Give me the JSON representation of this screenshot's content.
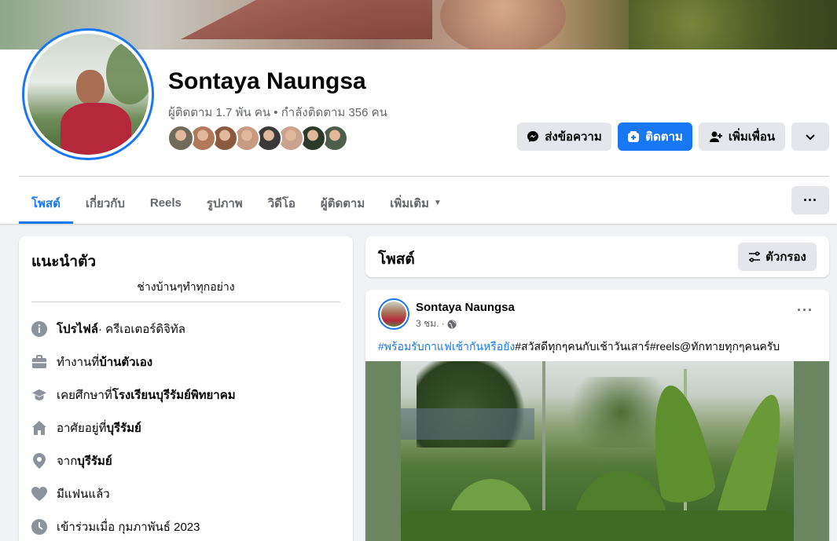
{
  "profile": {
    "name": "Sontaya Naungsa",
    "stats": "ผู้ติดตาม 1.7 พัน คน • กำลังติดตาม 356 คน",
    "friend_avatar_colors": [
      "#6f6a5a",
      "#b07a5a",
      "#8a5a3e",
      "#c89a82",
      "#3a3a3a",
      "#c9a38d",
      "#2d3a2a",
      "#4e5e4a"
    ]
  },
  "actions": {
    "message": "ส่งข้อความ",
    "follow": "ติดตาม",
    "add_friend": "เพิ่มเพื่อน"
  },
  "tabs": [
    "โพสต์",
    "เกี่ยวกับ",
    "Reels",
    "รูปภาพ",
    "วิดีโอ",
    "ผู้ติดตาม",
    "เพิ่มเติม"
  ],
  "intro": {
    "title": "แนะนำตัว",
    "bio": "ช่างบ้านๆทำทุกอย่าง",
    "items": [
      {
        "icon": "info-icon",
        "bold": "โปรไฟล์",
        "text": " · ครีเอเตอร์ดิจิทัล"
      },
      {
        "icon": "briefcase-icon",
        "text": "ทำงานที่ ",
        "bold": "บ้านตัวเอง"
      },
      {
        "icon": "graduation-cap-icon",
        "text": "เคยศึกษาที่ ",
        "bold": "โรงเรียนบุรีรัมย์พิทยาคม"
      },
      {
        "icon": "home-icon",
        "text": "อาศัยอยู่ที่ ",
        "bold": "บุรีรัมย์"
      },
      {
        "icon": "location-pin-icon",
        "text": "จาก ",
        "bold": "บุรีรัมย์"
      },
      {
        "icon": "heart-icon",
        "text": "มีแฟนแล้ว"
      },
      {
        "icon": "clock-icon",
        "text": "เข้าร่วมเมื่อ กุมภาพันธ์ 2023"
      }
    ]
  },
  "posts": {
    "title": "โพสต์",
    "filter_label": "ตัวกรอง",
    "post": {
      "author": "Sontaya Naungsa",
      "time": "3 ชม. ·",
      "hashtag": "#พร้อมรับกาแฟเช้ากันหรือยัง",
      "text": "#สวัสดีทุกๆคนกับเช้าวันเสาร์#reels@ทักทายทุกๆคนครับ"
    }
  }
}
